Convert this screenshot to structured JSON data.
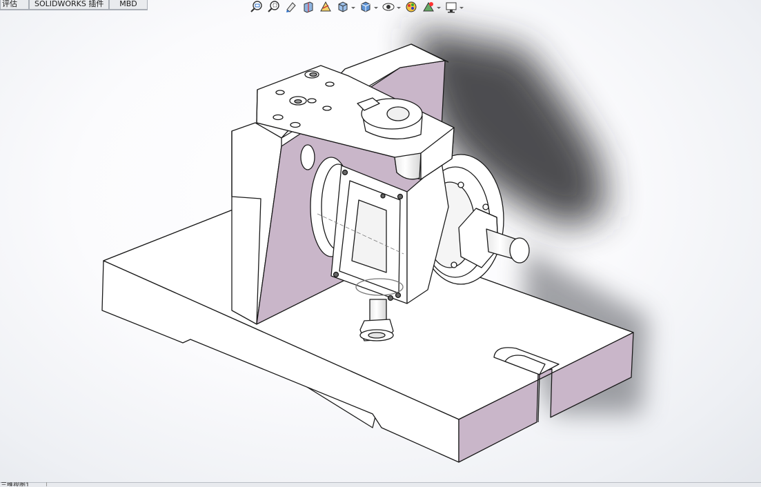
{
  "command_tabs": [
    {
      "label": "评估"
    },
    {
      "label": "SOLIDWORKS 插件"
    },
    {
      "label": "MBD"
    }
  ],
  "heads_up_toolbar": [
    {
      "icon": "zoom-to-fit-icon",
      "dropdown": false
    },
    {
      "icon": "zoom-to-area-icon",
      "dropdown": false
    },
    {
      "icon": "previous-view-icon",
      "dropdown": false
    },
    {
      "icon": "section-view-icon",
      "dropdown": false
    },
    {
      "icon": "dynamic-annotation-view-icon",
      "dropdown": false
    },
    {
      "icon": "view-orientation-icon",
      "dropdown": true
    },
    {
      "icon": "display-style-icon",
      "dropdown": true
    },
    {
      "icon": "hide-show-items-icon",
      "dropdown": true
    },
    {
      "icon": "edit-appearance-icon",
      "dropdown": false
    },
    {
      "icon": "apply-scene-icon",
      "dropdown": true
    },
    {
      "icon": "view-settings-icon",
      "dropdown": true
    }
  ],
  "bottom_tab": {
    "label": "三维视图1"
  },
  "colors": {
    "face_highlight": "#c9b6c9",
    "edge": "#1a1a1a",
    "shadow": "#3a3a3e"
  }
}
